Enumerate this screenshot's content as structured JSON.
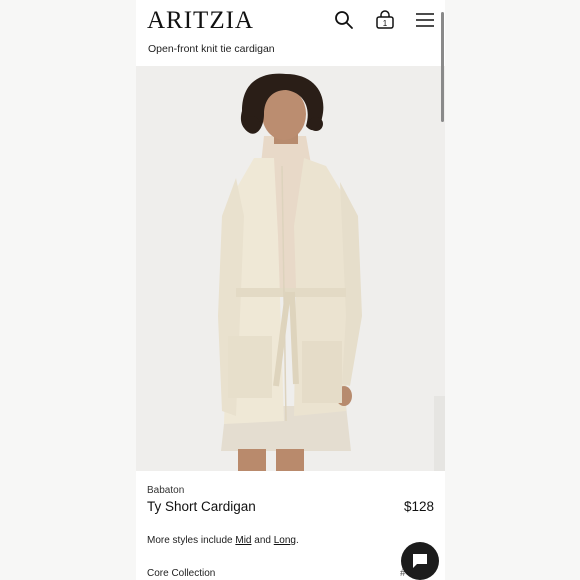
{
  "header": {
    "logo": "ARITZIA",
    "bag_count": "1",
    "breadcrumb_title": "Open-front knit tie cardigan"
  },
  "product": {
    "brand": "Babaton",
    "name": "Ty Short Cardigan",
    "price": "$128",
    "more_styles_prefix": "More styles include ",
    "style_mid": "Mid",
    "style_and": " and ",
    "style_long": "Long",
    "style_suffix": ".",
    "collection": "Core Collection",
    "collection_extra": "#"
  },
  "icons": {
    "search": "search-icon",
    "bag": "shopping-bag-icon",
    "menu": "hamburger-menu-icon",
    "chat": "chat-bubble-icon"
  },
  "colors": {
    "cardigan": "#efe8d6",
    "background": "#efeeec",
    "chat_button": "#1c1c1c"
  }
}
